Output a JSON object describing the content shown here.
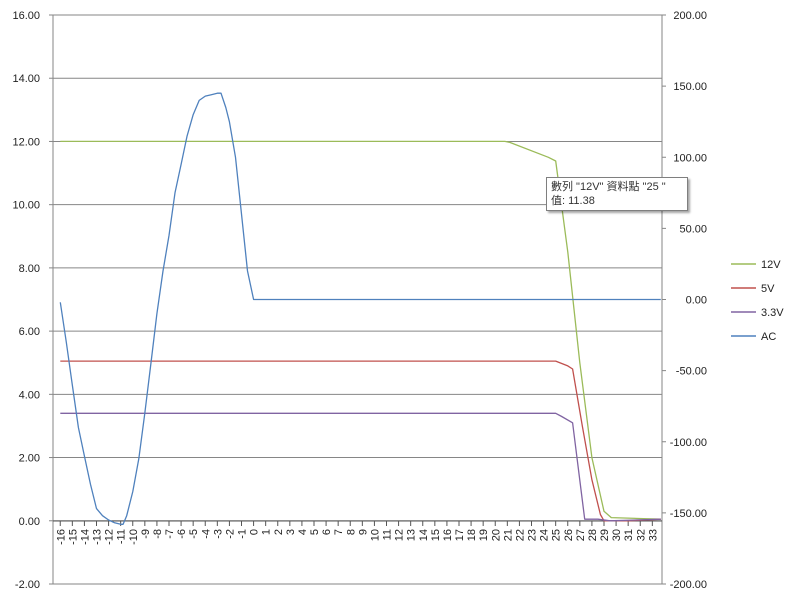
{
  "chart_data": {
    "type": "line",
    "x_categories": [
      "-16",
      "-15",
      "-14",
      "-13",
      "-12",
      "-11",
      "-10",
      "-9",
      "-8",
      "-7",
      "-6",
      "-5",
      "-4",
      "-3",
      "-2",
      "-1",
      "0",
      "1",
      "2",
      "3",
      "4",
      "5",
      "6",
      "7",
      "8",
      "9",
      "10",
      "11",
      "12",
      "13",
      "14",
      "15",
      "16",
      "17",
      "18",
      "19",
      "20",
      "21",
      "22",
      "23",
      "24",
      "25",
      "26",
      "27",
      "28",
      "29",
      "30",
      "31",
      "32",
      "33"
    ],
    "y_left": {
      "ticks": [
        "16.00",
        "14.00",
        "12.00",
        "10.00",
        "8.00",
        "6.00",
        "4.00",
        "2.00",
        "0.00",
        "-2.00"
      ],
      "ylim": [
        -2,
        16
      ]
    },
    "y_right": {
      "ticks": [
        "200.00",
        "150.00",
        "100.00",
        "50.00",
        "0.00",
        "-50.00",
        "-100.00",
        "-150.00",
        "-200.00"
      ],
      "ylim": [
        -200,
        200
      ]
    },
    "grid": true,
    "legend_position": "right",
    "series": [
      {
        "name": "12V",
        "axis": "left",
        "color": "#9bbb59",
        "points": [
          [
            -16,
            12.0
          ],
          [
            20.8,
            12.0
          ],
          [
            21.2,
            11.97
          ],
          [
            24.4,
            11.5
          ],
          [
            25,
            11.38
          ],
          [
            26,
            8.5
          ],
          [
            27,
            5.0
          ],
          [
            28,
            2.0
          ],
          [
            29,
            0.3
          ],
          [
            29.6,
            0.1
          ],
          [
            33.7,
            0.05
          ]
        ]
      },
      {
        "name": "5V",
        "axis": "left",
        "color": "#c0504d",
        "points": [
          [
            -16,
            5.05
          ],
          [
            25,
            5.05
          ],
          [
            26,
            4.9
          ],
          [
            26.4,
            4.8
          ],
          [
            27.2,
            3.0
          ],
          [
            28,
            1.3
          ],
          [
            28.7,
            0.2
          ],
          [
            29,
            0.0
          ],
          [
            31,
            0.0
          ],
          [
            33.7,
            0.05
          ]
        ]
      },
      {
        "name": "3.3V",
        "axis": "left",
        "color": "#8064a2",
        "points": [
          [
            -16,
            3.4
          ],
          [
            25,
            3.4
          ],
          [
            25.5,
            3.3
          ],
          [
            26.4,
            3.1
          ],
          [
            27.4,
            0.05
          ],
          [
            28.5,
            0.05
          ],
          [
            29.5,
            0.0
          ],
          [
            33.7,
            0.05
          ]
        ]
      },
      {
        "name": "AC",
        "axis": "right",
        "color": "#4f81bd",
        "points": [
          [
            -16,
            -2
          ],
          [
            -15.5,
            -30
          ],
          [
            -15,
            -60
          ],
          [
            -14.5,
            -90
          ],
          [
            -14,
            -110
          ],
          [
            -13.5,
            -130
          ],
          [
            -13,
            -147
          ],
          [
            -12.5,
            -152
          ],
          [
            -12,
            -155
          ],
          [
            -11.5,
            -157
          ],
          [
            -11,
            -158
          ],
          [
            -10.8,
            -158
          ],
          [
            -10.5,
            -152
          ],
          [
            -10,
            -135
          ],
          [
            -9.5,
            -112
          ],
          [
            -9,
            -80
          ],
          [
            -8.5,
            -45
          ],
          [
            -8,
            -10
          ],
          [
            -7.5,
            20
          ],
          [
            -7,
            45
          ],
          [
            -6.5,
            75
          ],
          [
            -6,
            95
          ],
          [
            -5.5,
            115
          ],
          [
            -5,
            130
          ],
          [
            -4.5,
            140
          ],
          [
            -4,
            143
          ],
          [
            -3.5,
            144
          ],
          [
            -3,
            145
          ],
          [
            -2.7,
            145
          ],
          [
            -2.3,
            135
          ],
          [
            -2,
            125
          ],
          [
            -1.5,
            100
          ],
          [
            -1,
            60
          ],
          [
            -0.5,
            20
          ],
          [
            0,
            0
          ],
          [
            33.7,
            0
          ]
        ]
      }
    ]
  },
  "legend": {
    "items": [
      {
        "name": "12V",
        "color": "#9bbb59"
      },
      {
        "name": "5V",
        "color": "#c0504d"
      },
      {
        "name": "3.3V",
        "color": "#8064a2"
      },
      {
        "name": "AC",
        "color": "#4f81bd"
      }
    ]
  },
  "tooltip": {
    "line1": "數列 \"12V\" 資料點 \"25 \"",
    "line2": "值: 11.38"
  },
  "colors": {
    "grid": "#868686",
    "axis": "#868686",
    "background": "#ffffff"
  }
}
